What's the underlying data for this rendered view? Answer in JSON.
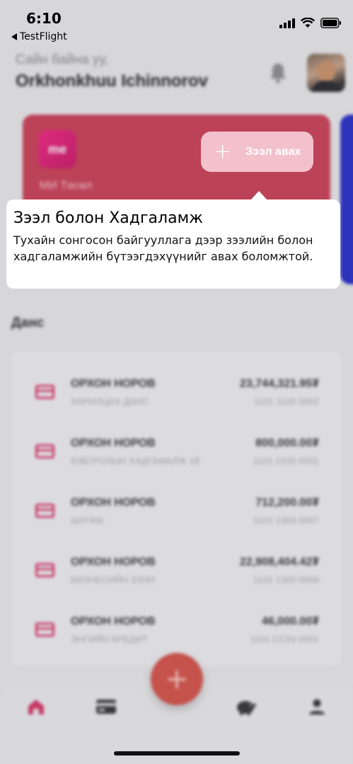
{
  "status_bar": {
    "time": "6:10",
    "back_app": "TestFlight"
  },
  "header": {
    "greeting": "Сайн байна уу,",
    "user_name": "Orkhonkhuu Ichinnorov"
  },
  "card": {
    "logo_text": "me",
    "name": "МИ Төсөл",
    "action_label": "Зээл авах",
    "color": "#c9455c"
  },
  "tooltip": {
    "title": "Зээл болон Хадгаламж",
    "body": "Тухайн сонгосон байгууллага дээр зээлийн болон хадгаламжийн бүтээгдэхүүнийг авах боломжтой."
  },
  "accounts_section": {
    "title": "Данс",
    "accounts": [
      {
        "holder": "ОРХОН НОРОВ",
        "type": "ХАРИЛЦАХ ДАНС",
        "balance": "23,744,321.95₮",
        "number": "1101 1100 0002"
      },
      {
        "holder": "ОРХОН НОРОВ",
        "type": "ЮВСРОЛЫН ХАДГАМАЛЖ 18",
        "balance": "800,000.00₮",
        "number": "1101 2100 0001"
      },
      {
        "holder": "ОРХОН НОРОВ",
        "type": "ШУГАМ",
        "balance": "712,200.00₮",
        "number": "1101 1300 0007"
      },
      {
        "holder": "ОРХОН НОРОВ",
        "type": "БИЗНЕСИЙН ЗЭЭЛ",
        "balance": "22,908,404.42₮",
        "number": "1101 1300 0006"
      },
      {
        "holder": "ОРХОН НОРОВ",
        "type": "ЭНГИЙН КРЕДИТ",
        "balance": "46,000.00₮",
        "number": "1101 CC00 0001"
      }
    ]
  },
  "tabbar": {
    "fab_label": "+",
    "accent": "#d63a6a"
  }
}
